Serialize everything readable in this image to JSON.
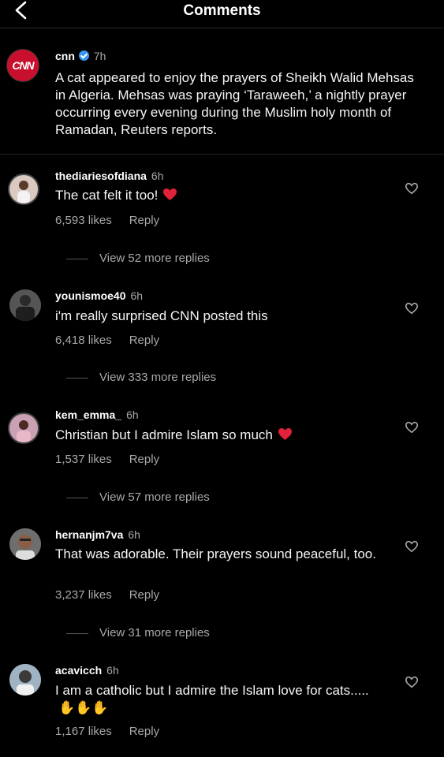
{
  "header": {
    "title": "Comments",
    "back_icon": "chevron-left-icon"
  },
  "caption": {
    "username": "cnn",
    "verified": true,
    "time": "7h",
    "avatar_logo": "CNN",
    "text": "A cat appeared to enjoy the prayers of Sheikh Walid Mehsas in Algeria. Mehsas was praying ‘Taraweeh,’ a nightly prayer occurring every evening during the Muslim holy month of Ramadan, Reuters reports."
  },
  "comments": [
    {
      "username": "thediariesofdiana",
      "time": "6h",
      "text": "The cat felt it too!",
      "emoji": "red-heart",
      "likes": "6,593 likes",
      "reply": "Reply",
      "more_replies": "View 52 more replies",
      "avatar_color": "#d9c9c0"
    },
    {
      "username": "younismoe40",
      "time": "6h",
      "text": "i'm really surprised CNN posted this",
      "emoji": "",
      "likes": "6,418 likes",
      "reply": "Reply",
      "more_replies": "View 333 more replies",
      "avatar_color": "#3a3a3a"
    },
    {
      "username": "kem_emma_",
      "time": "6h",
      "text": "Christian but I admire Islam so much",
      "emoji": "red-heart",
      "likes": "1,537 likes",
      "reply": "Reply",
      "more_replies": "View 57 more replies",
      "avatar_color": "#b78a7a"
    },
    {
      "username": "hernanjm7va",
      "time": "6h",
      "text": "That was adorable. Their prayers sound peaceful, too.",
      "emoji": "",
      "likes": "3,237 likes",
      "reply": "Reply",
      "more_replies": "View 31 more replies",
      "avatar_color": "#7a5a48"
    },
    {
      "username": "acavicch",
      "time": "6h",
      "text": "I am a catholic but I admire the Islam love for cats.....",
      "emoji": "clapping-hands-x3",
      "likes": "1,167 likes",
      "reply": "Reply",
      "more_replies": "",
      "avatar_color": "#8aa0b0"
    }
  ],
  "colors": {
    "background": "#000000",
    "secondary_text": "#a8a8a8",
    "verified": "#3897f0",
    "heart": "#e0223a"
  }
}
